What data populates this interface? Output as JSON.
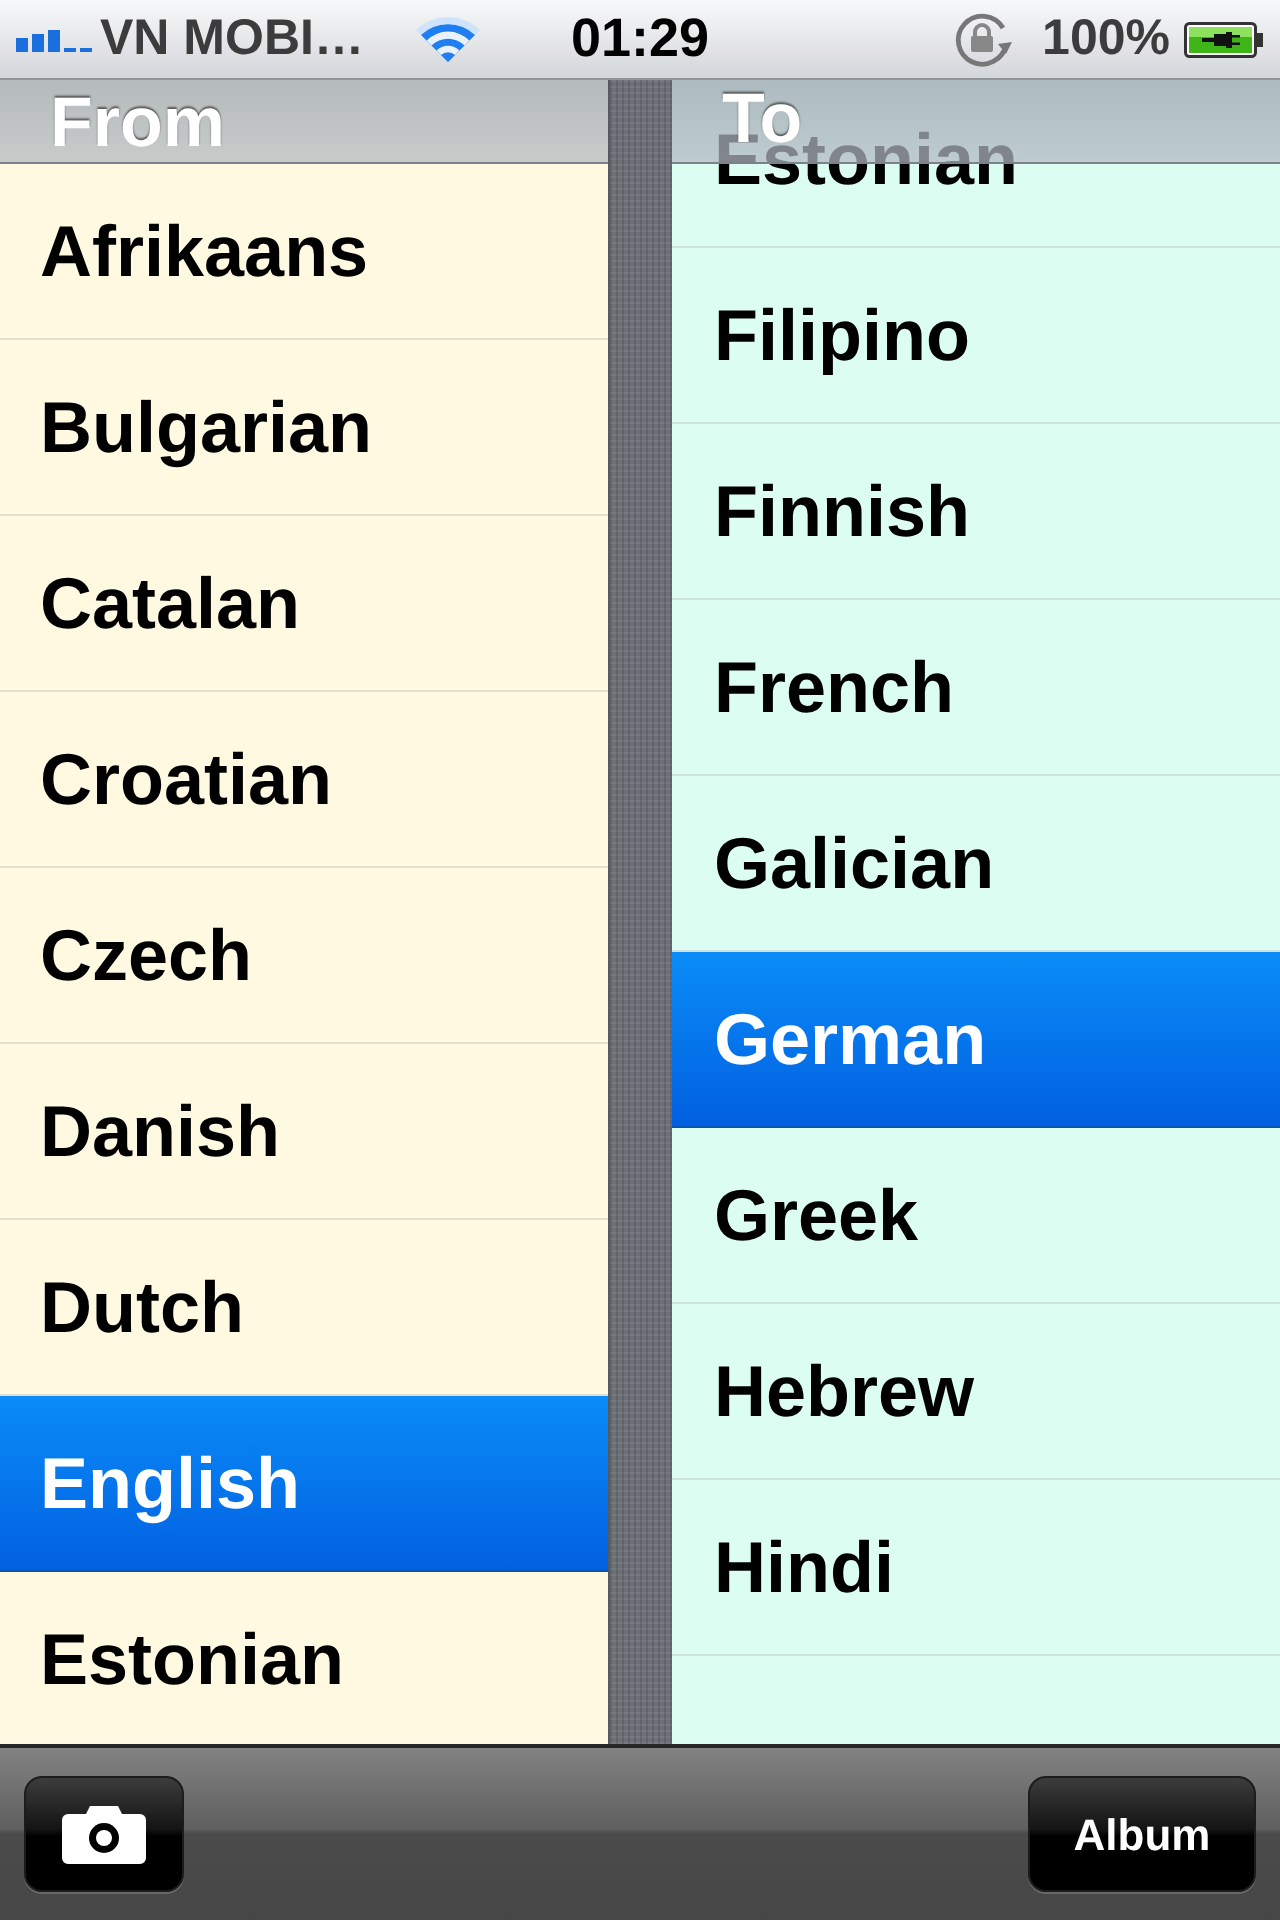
{
  "status_bar": {
    "carrier": "VN MOBI…",
    "time": "01:29",
    "battery": "100%"
  },
  "from_panel": {
    "title": "From",
    "languages": [
      {
        "label": "Afrikaans",
        "selected": false
      },
      {
        "label": "Bulgarian",
        "selected": false
      },
      {
        "label": "Catalan",
        "selected": false
      },
      {
        "label": "Croatian",
        "selected": false
      },
      {
        "label": "Czech",
        "selected": false
      },
      {
        "label": "Danish",
        "selected": false
      },
      {
        "label": "Dutch",
        "selected": false
      },
      {
        "label": "English",
        "selected": true
      },
      {
        "label": "Estonian",
        "selected": false
      }
    ]
  },
  "to_panel": {
    "title": "To",
    "languages": [
      {
        "label": "Estonian",
        "selected": false
      },
      {
        "label": "Filipino",
        "selected": false
      },
      {
        "label": "Finnish",
        "selected": false
      },
      {
        "label": "French",
        "selected": false
      },
      {
        "label": "Galician",
        "selected": false
      },
      {
        "label": "German",
        "selected": true
      },
      {
        "label": "Greek",
        "selected": false
      },
      {
        "label": "Hebrew",
        "selected": false
      },
      {
        "label": "Hindi",
        "selected": false
      }
    ]
  },
  "toolbar": {
    "album_button": "Album"
  }
}
